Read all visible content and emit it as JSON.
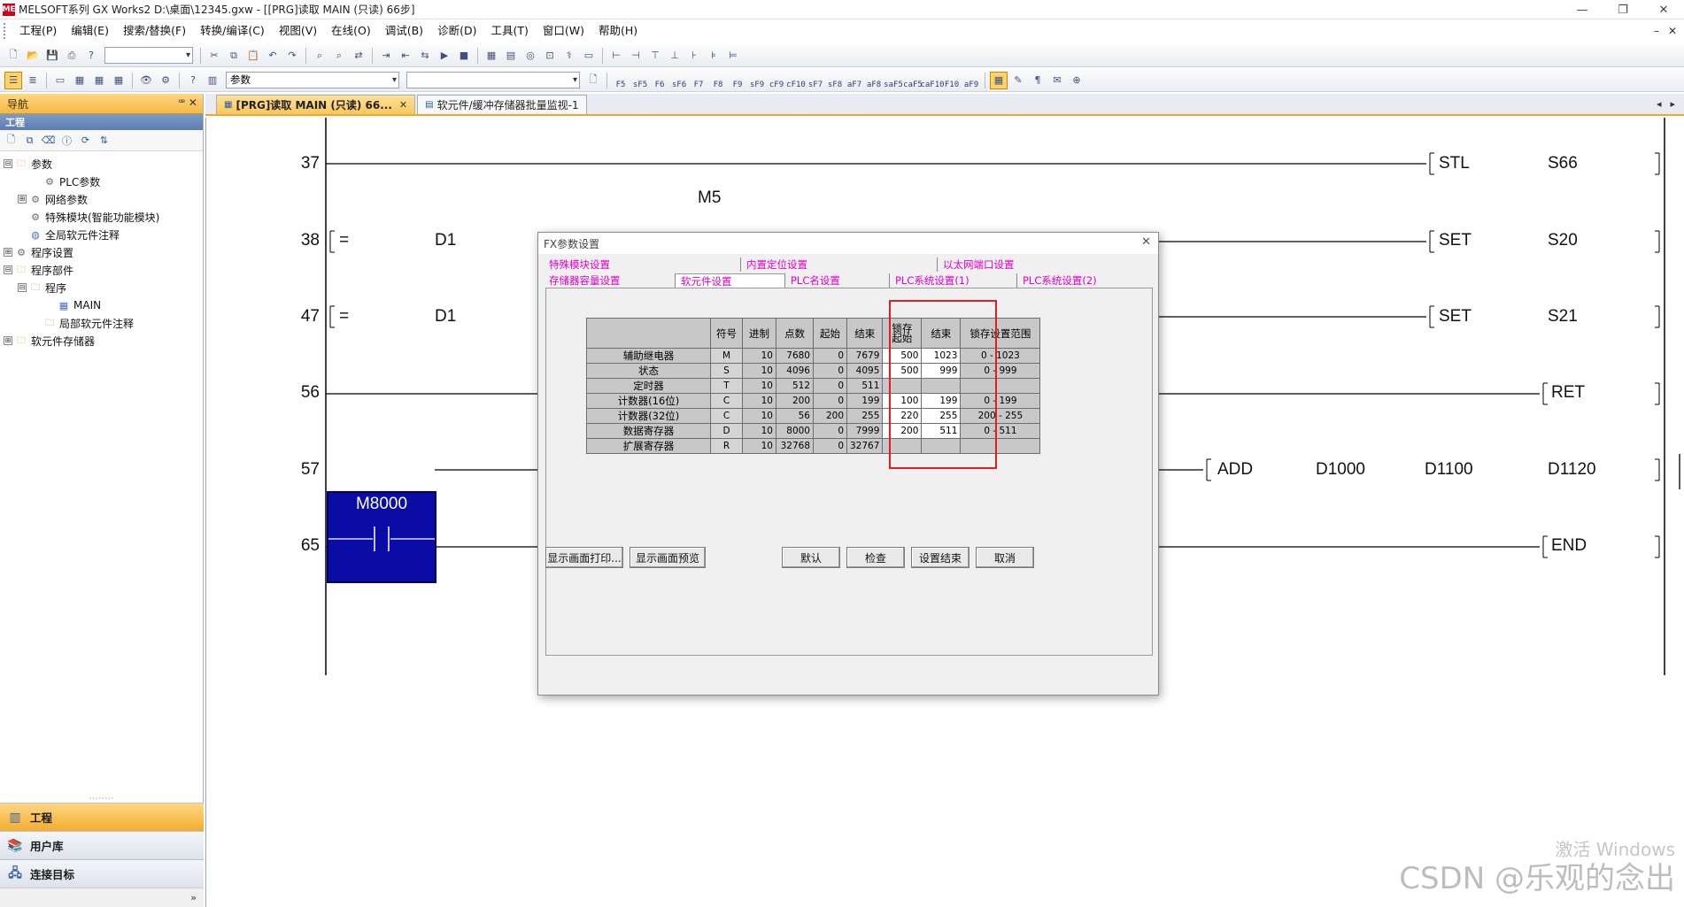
{
  "window": {
    "title": "MELSOFT系列 GX Works2 D:\\桌面\\12345.gxw - [[PRG]读取 MAIN (只读) 66步]",
    "logo_text": "ME"
  },
  "menu": [
    "工程(P)",
    "编辑(E)",
    "搜索/替换(F)",
    "转换/编译(C)",
    "视图(V)",
    "在线(O)",
    "调试(B)",
    "诊断(D)",
    "工具(T)",
    "窗口(W)",
    "帮助(H)"
  ],
  "toolbar": {
    "combo_value": "参数",
    "ladder_keys": [
      "F5",
      "sF5",
      "F6",
      "sF6",
      "F7",
      "F8",
      "F9",
      "sF9",
      "cF9",
      "cF10",
      "sF7",
      "sF8",
      "aF7",
      "aF8",
      "saF5",
      "caF5",
      "caF10",
      "F10",
      "aF9"
    ]
  },
  "nav": {
    "header": "导航",
    "header_ctrls": "ꟹ ✕",
    "section": "工程",
    "tree": [
      {
        "label": "参数",
        "level": 0,
        "pm": "⊟",
        "icon": "folder"
      },
      {
        "label": "PLC参数",
        "level": 2,
        "pm": "",
        "icon": "gear"
      },
      {
        "label": "网络参数",
        "level": 1,
        "pm": "⊞",
        "icon": "gear"
      },
      {
        "label": "特殊模块(智能功能模块)",
        "level": 1,
        "pm": "",
        "icon": "gear"
      },
      {
        "label": "全局软元件注释",
        "level": 1,
        "pm": "",
        "icon": "globe"
      },
      {
        "label": "程序设置",
        "level": 0,
        "pm": "⊞",
        "icon": "gear"
      },
      {
        "label": "程序部件",
        "level": 0,
        "pm": "⊟",
        "icon": "folder"
      },
      {
        "label": "程序",
        "level": 1,
        "pm": "⊟",
        "icon": "folder"
      },
      {
        "label": "MAIN",
        "level": 3,
        "pm": "",
        "icon": "doc"
      },
      {
        "label": "局部软元件注释",
        "level": 2,
        "pm": "",
        "icon": "folder"
      },
      {
        "label": "软元件存储器",
        "level": 0,
        "pm": "⊞",
        "icon": "folder"
      }
    ],
    "bottom_tabs": [
      "工程",
      "用户库",
      "连接目标"
    ]
  },
  "tabs": [
    {
      "label": "[PRG]读取 MAIN (只读) 66...",
      "active": true,
      "close": "✕"
    },
    {
      "label": "软元件/缓冲存储器批量监视-1",
      "active": false,
      "close": ""
    }
  ],
  "ladder": {
    "rungs": [
      {
        "num": "37",
        "coil": "STL",
        "arg": "S66"
      },
      {
        "num": "38",
        "cmp": "=",
        "op": "D1",
        "coil": "SET",
        "arg": "S20"
      },
      {
        "num": "47",
        "cmp": "=",
        "op": "D1",
        "coil": "SET",
        "arg": "S21"
      },
      {
        "num": "56",
        "coil": "RET"
      },
      {
        "num": "57",
        "contact": "M8000",
        "coil": "ADD",
        "args": [
          "D1000",
          "D1100",
          "D1120"
        ]
      },
      {
        "num": "65",
        "coil": "END"
      }
    ],
    "m5_label": "M5"
  },
  "dialog": {
    "title": "FX参数设置",
    "close": "✕",
    "tabs_row1": [
      "特殊模块设置",
      "内置定位设置",
      "以太网端口设置"
    ],
    "tabs_row2": [
      "存储器容量设置",
      "软元件设置",
      "PLC名设置",
      "PLC系统设置(1)",
      "PLC系统设置(2)"
    ],
    "table": {
      "headers": [
        "",
        "符号",
        "进制",
        "点数",
        "起始",
        "结束",
        "锁存\n起始",
        "结束",
        "锁存设置范围"
      ],
      "rows": [
        {
          "name": "辅助继电器",
          "sym": "M",
          "base": "10",
          "points": "7680",
          "start": "0",
          "end": "7679",
          "lstart": "500",
          "lend": "1023",
          "range": "0 - 1023"
        },
        {
          "name": "状态",
          "sym": "S",
          "base": "10",
          "points": "4096",
          "start": "0",
          "end": "4095",
          "lstart": "500",
          "lend": "999",
          "range": "0 - 999"
        },
        {
          "name": "定时器",
          "sym": "T",
          "base": "10",
          "points": "512",
          "start": "0",
          "end": "511",
          "lstart": "",
          "lend": "",
          "range": ""
        },
        {
          "name": "计数器(16位)",
          "sym": "C",
          "base": "10",
          "points": "200",
          "start": "0",
          "end": "199",
          "lstart": "100",
          "lend": "199",
          "range": "0 - 199"
        },
        {
          "name": "计数器(32位)",
          "sym": "C",
          "base": "10",
          "points": "56",
          "start": "200",
          "end": "255",
          "lstart": "220",
          "lend": "255",
          "range": "200 - 255"
        },
        {
          "name": "数据寄存器",
          "sym": "D",
          "base": "10",
          "points": "8000",
          "start": "0",
          "end": "7999",
          "lstart": "200",
          "lend": "511",
          "range": "0 - 511"
        },
        {
          "name": "扩展寄存器",
          "sym": "R",
          "base": "10",
          "points": "32768",
          "start": "0",
          "end": "32767",
          "lstart": "",
          "lend": "",
          "range": ""
        }
      ]
    },
    "buttons": {
      "print": "显示画面打印...",
      "preview": "显示画面预览",
      "default": "默认",
      "check": "检查",
      "finish": "设置结束",
      "cancel": "取消"
    }
  },
  "watermark": {
    "line1": "激活 Windows",
    "line2": "CSDN @乐观的念出"
  },
  "colors": {
    "accent": "#f6b943",
    "contact_bg": "#0b0ca6",
    "highlight_box": "#e02020",
    "dialog_tab_text": "#e000c8"
  }
}
